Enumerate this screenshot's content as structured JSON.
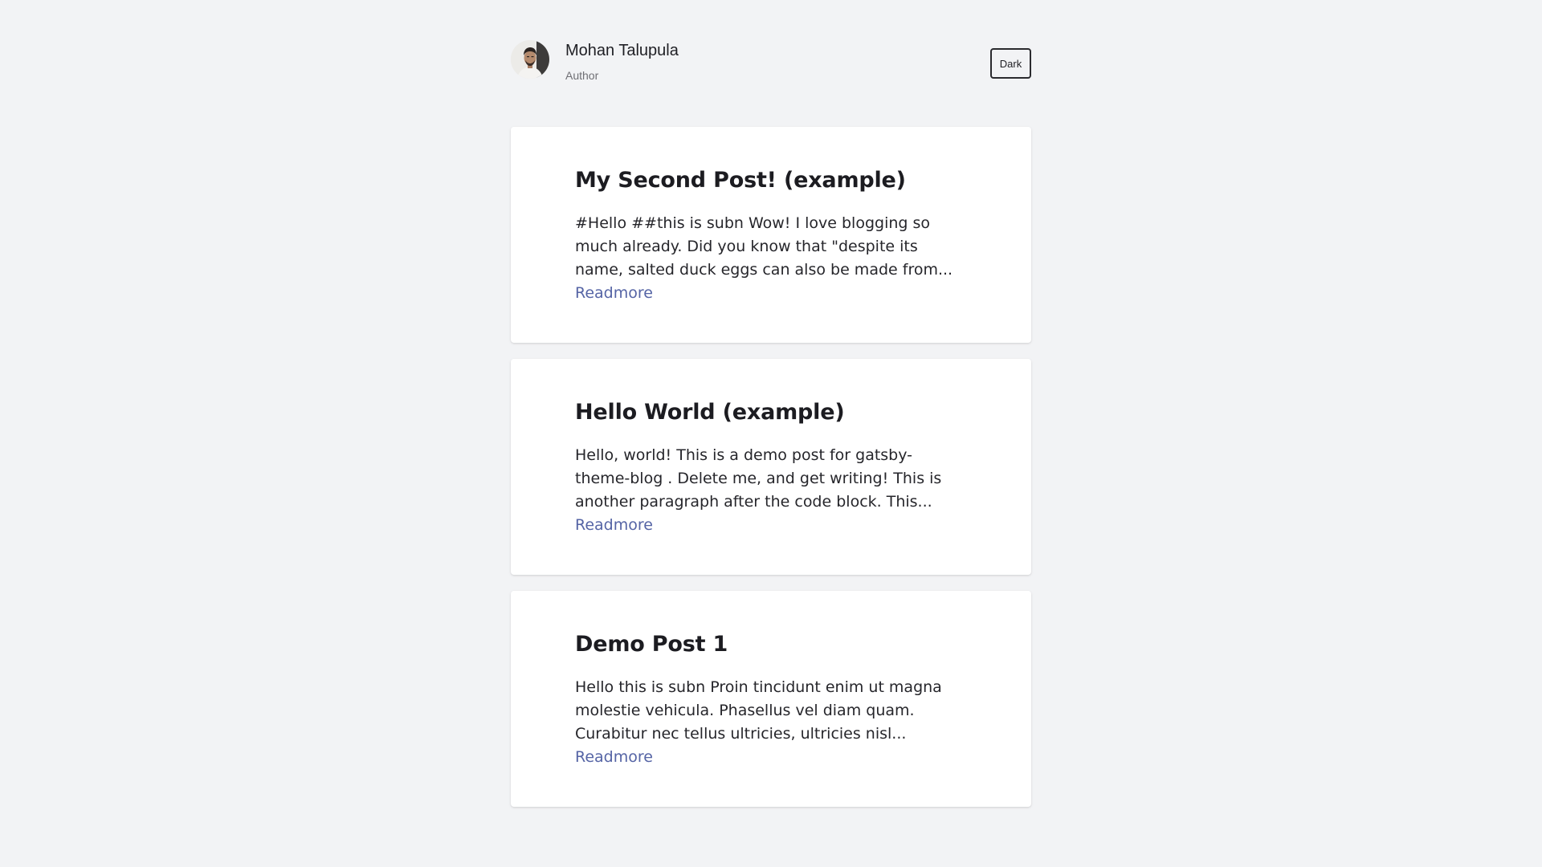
{
  "author": {
    "name": "Mohan Talupula",
    "role": "Author"
  },
  "theme_toggle": {
    "label": "Dark"
  },
  "posts": [
    {
      "title": "My Second Post! (example)",
      "excerpt": "#Hello ##this is subn Wow! I love blogging so much already. Did you know that \"despite its name, salted duck eggs can also be made from...",
      "readmore": "Readmore"
    },
    {
      "title": "Hello World (example)",
      "excerpt": "Hello, world! This is a demo post for gatsby-theme-blog . Delete me, and get writing! This is another paragraph after the code block. This...",
      "readmore": "Readmore"
    },
    {
      "title": "Demo Post 1",
      "excerpt": "Hello this is subn Proin tincidunt enim ut magna molestie vehicula. Phasellus vel diam quam. Curabitur nec tellus ultricies, ultricies nisl...",
      "readmore": "Readmore"
    }
  ],
  "colors": {
    "background": "#f2f3f5",
    "card": "#ffffff",
    "link": "#5564a5",
    "text": "#1c1c21"
  }
}
